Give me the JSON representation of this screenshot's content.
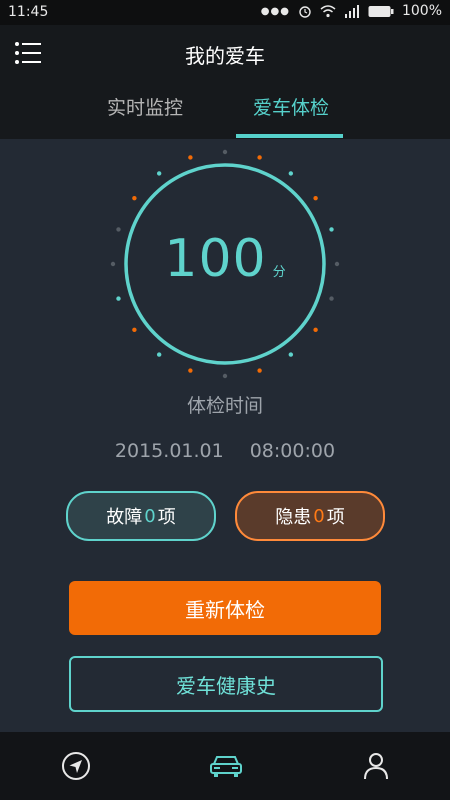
{
  "status_bar": {
    "time": "11:45",
    "battery": "100%"
  },
  "header": {
    "title": "我的爱车",
    "tabs": [
      {
        "label": "实时监控",
        "active": false
      },
      {
        "label": "爱车体检",
        "active": true
      }
    ]
  },
  "checkup": {
    "score": "100",
    "score_unit": "分",
    "time_label": "体检时间",
    "date": "2015.01.01",
    "time": "08:00:00",
    "faults": {
      "prefix": "故障",
      "count": "0",
      "suffix": "项"
    },
    "hazards": {
      "prefix": "隐患",
      "count": "0",
      "suffix": "项"
    },
    "recheck_button": "重新体检",
    "history_button": "爱车健康史"
  },
  "bottom_nav": {
    "items": [
      {
        "icon": "navigation-arrow-icon"
      },
      {
        "icon": "car-icon"
      },
      {
        "icon": "user-icon"
      }
    ]
  },
  "colors": {
    "accent_teal": "#5fd3cc",
    "accent_orange": "#f26b06",
    "background": "#232a34"
  }
}
